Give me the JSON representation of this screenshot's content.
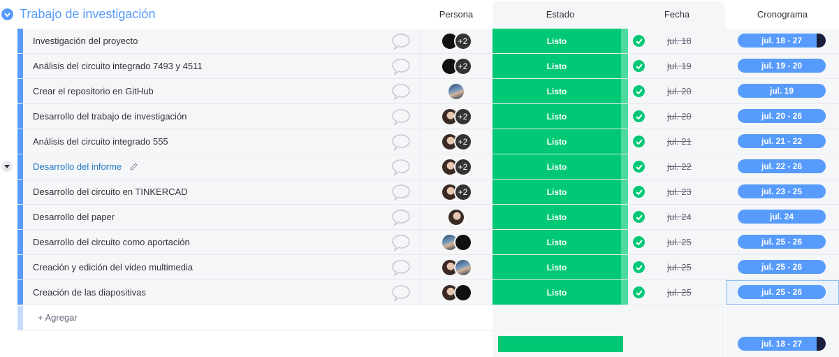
{
  "group": {
    "title": "Trabajo de investigación",
    "color": "#579bfc"
  },
  "columns": {
    "persona": "Persona",
    "estado": "Estado",
    "fecha": "Fecha",
    "cronograma": "Cronograma"
  },
  "colors": {
    "status_done": "#00c875",
    "timeline": "#579bfc",
    "timeline_progress": "#1c1f3b"
  },
  "rows": [
    {
      "name": "Investigación del proyecto",
      "people": [
        "black",
        "+2"
      ],
      "status": "Listo",
      "date": "jul. 18",
      "timeline": "jul. 18 - 27"
    },
    {
      "name": "Análisis del circuito integrado 7493 y 4511",
      "people": [
        "black",
        "+2"
      ],
      "status": "Listo",
      "date": "jul. 19",
      "timeline": "jul. 19 - 20"
    },
    {
      "name": "Crear el repositorio en GitHub",
      "people": [
        "person"
      ],
      "status": "Listo",
      "date": "jul. 20",
      "timeline": "jul. 19"
    },
    {
      "name": "Desarrollo del trabajo de investigación",
      "people": [
        "face",
        "+2"
      ],
      "status": "Listo",
      "date": "jul. 20",
      "timeline": "jul. 20 - 26"
    },
    {
      "name": "Análisis del circuito integrado 555",
      "people": [
        "face",
        "+2"
      ],
      "status": "Listo",
      "date": "jul. 21",
      "timeline": "jul. 21 - 22"
    },
    {
      "name": "Desarrollo del informe",
      "people": [
        "face",
        "+2"
      ],
      "status": "Listo",
      "date": "jul. 22",
      "timeline": "jul. 22 - 26"
    },
    {
      "name": "Desarrollo del circuito en TINKERCAD",
      "people": [
        "face",
        "+2"
      ],
      "status": "Listo",
      "date": "jul. 23",
      "timeline": "jul. 23 - 25"
    },
    {
      "name": "Desarrollo del paper",
      "people": [
        "face"
      ],
      "status": "Listo",
      "date": "jul. 24",
      "timeline": "jul. 24"
    },
    {
      "name": "Desarrollo del circuito como aportación",
      "people": [
        "person",
        "black"
      ],
      "status": "Listo",
      "date": "jul. 25",
      "timeline": "jul. 25 - 26"
    },
    {
      "name": "Creación y edición del video multimedia",
      "people": [
        "face",
        "person"
      ],
      "status": "Listo",
      "date": "jul. 25",
      "timeline": "jul. 25 - 26"
    },
    {
      "name": "Creación de las diapositivas",
      "people": [
        "face",
        "black"
      ],
      "status": "Listo",
      "date": "jul. 25",
      "timeline": "jul. 25 - 26"
    }
  ],
  "add_item": "+ Agregar",
  "summary": {
    "timeline": "jul. 18 - 27"
  }
}
